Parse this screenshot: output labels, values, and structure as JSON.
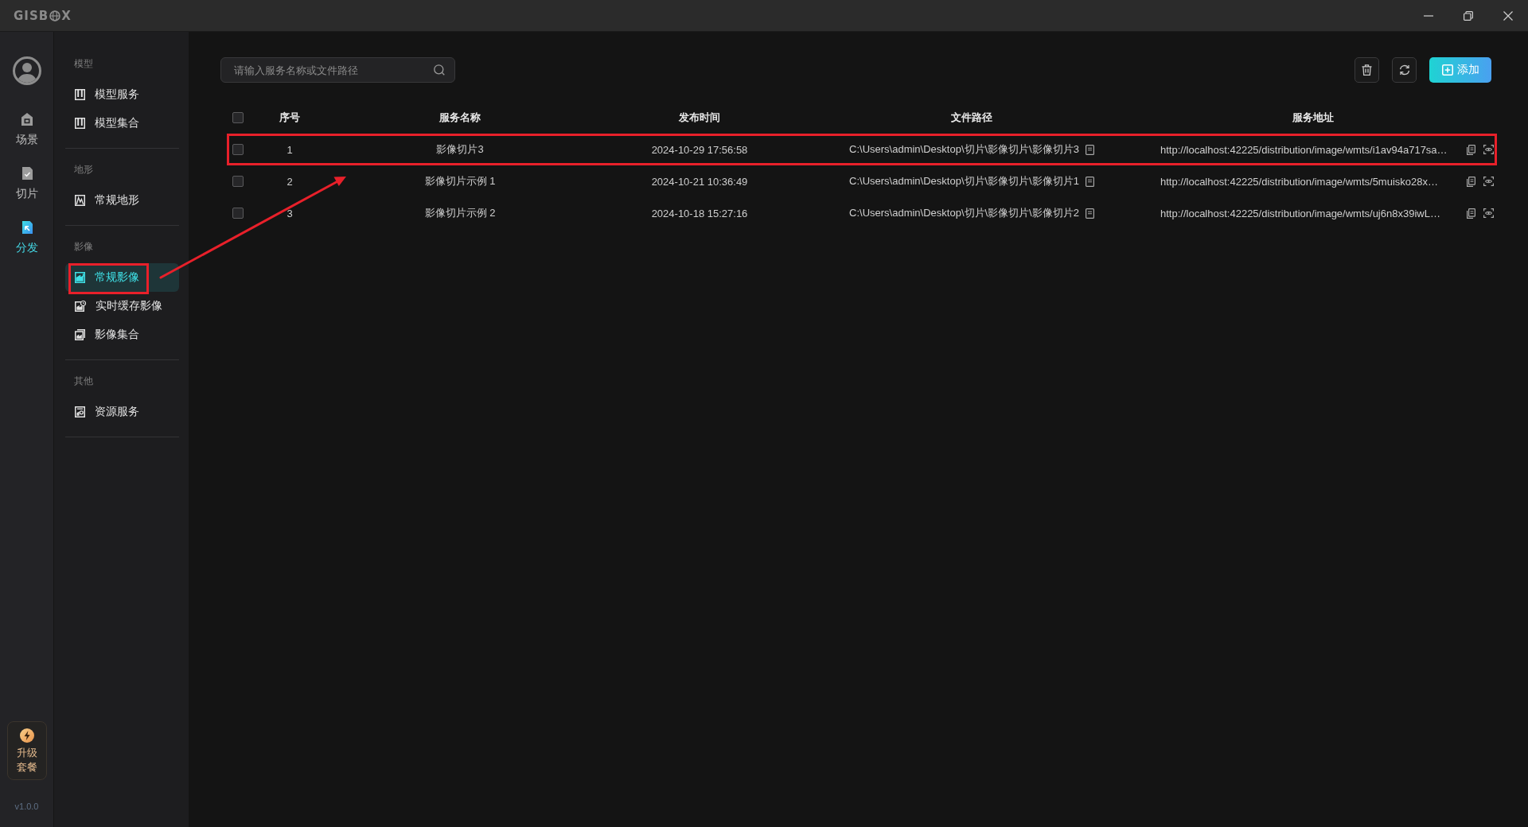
{
  "app_logo": {
    "prefix": "GISB",
    "suffix": "X"
  },
  "rail": {
    "items": [
      {
        "label": "场景",
        "selected": false
      },
      {
        "label": "切片",
        "selected": false
      },
      {
        "label": "分发",
        "selected": true
      }
    ],
    "upgrade_button": "升级套餐",
    "version": "v1.0.0"
  },
  "nav": {
    "sections": [
      {
        "title": "模型",
        "items": [
          {
            "label": "模型服务",
            "selected": false,
            "highlighted": false
          },
          {
            "label": "模型集合",
            "selected": false,
            "highlighted": false
          }
        ]
      },
      {
        "title": "地形",
        "items": [
          {
            "label": "常规地形",
            "selected": false,
            "highlighted": false
          }
        ]
      },
      {
        "title": "影像",
        "items": [
          {
            "label": "常规影像",
            "selected": true,
            "highlighted": true
          },
          {
            "label": "实时缓存影像",
            "selected": false,
            "highlighted": false
          },
          {
            "label": "影像集合",
            "selected": false,
            "highlighted": false
          }
        ]
      },
      {
        "title": "其他",
        "items": [
          {
            "label": "资源服务",
            "selected": false,
            "highlighted": false
          }
        ]
      }
    ]
  },
  "search": {
    "placeholder": "请输入服务名称或文件路径"
  },
  "toolbar": {
    "add_button": "添加"
  },
  "table": {
    "select_all": {
      "checked": false
    },
    "columns": [
      "序号",
      "服务名称",
      "发布时间",
      "文件路径",
      "服务地址"
    ],
    "rows": [
      {
        "checked": false,
        "highlighted": true,
        "number": "1",
        "name": "影像切片3",
        "published": "2024-10-29 17:56:58",
        "path": "C:\\Users\\admin\\Desktop\\切片\\影像切片\\影像切片3",
        "address": "http://localhost:42225/distribution/image/wmts/i1av94a717sa…"
      },
      {
        "checked": false,
        "highlighted": false,
        "number": "2",
        "name": "影像切片示例 1",
        "published": "2024-10-21 10:36:49",
        "path": "C:\\Users\\admin\\Desktop\\切片\\影像切片\\影像切片1",
        "address": "http://localhost:42225/distribution/image/wmts/5muisko28x…"
      },
      {
        "checked": false,
        "highlighted": false,
        "number": "3",
        "name": "影像切片示例 2",
        "published": "2024-10-18 15:27:16",
        "path": "C:\\Users\\admin\\Desktop\\切片\\影像切片\\影像切片2",
        "address": "http://localhost:42225/distribution/image/wmts/uj6n8x39iwL…"
      }
    ]
  },
  "annotation_arrow": true
}
